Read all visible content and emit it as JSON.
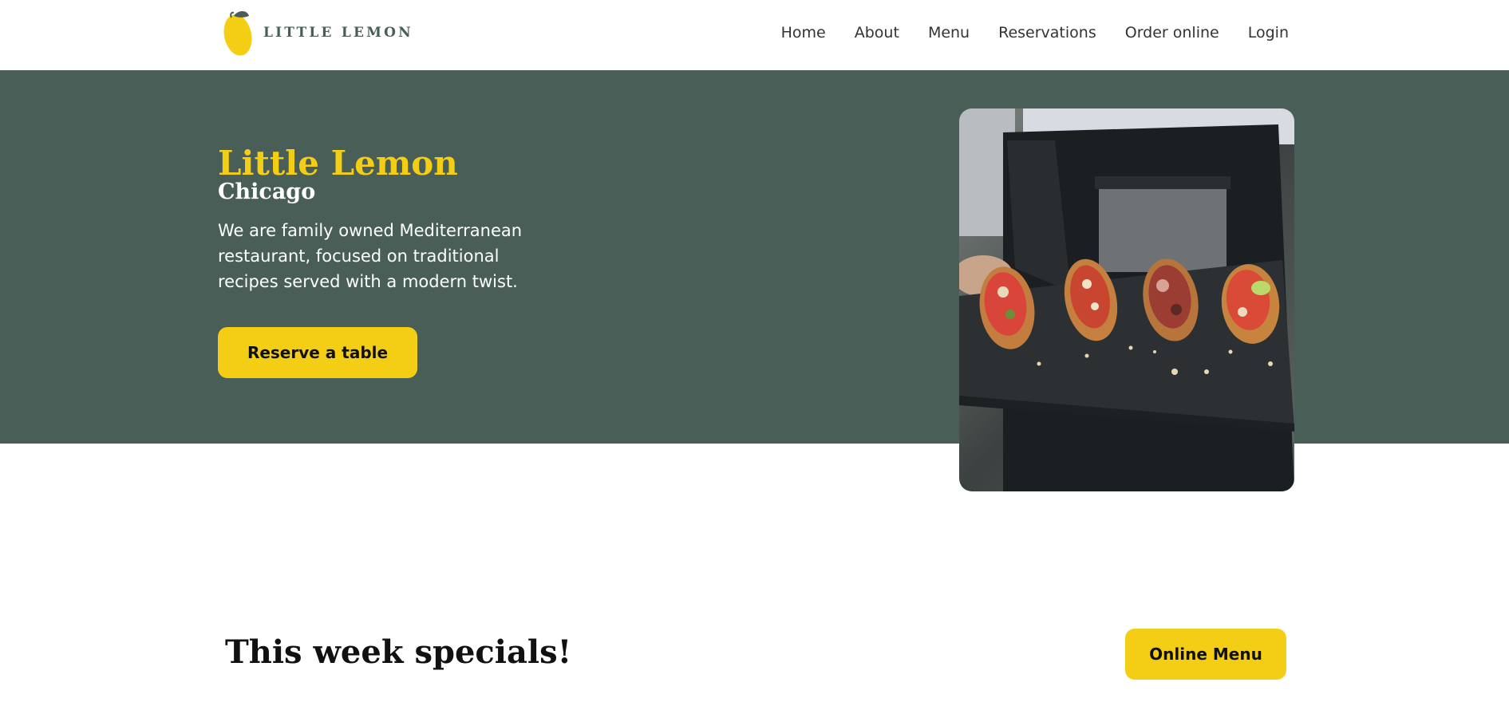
{
  "brand": {
    "name": "LITTLE LEMON",
    "primary_color": "#495E57",
    "accent_color": "#F4CE14"
  },
  "nav": {
    "items": [
      "Home",
      "About",
      "Menu",
      "Reservations",
      "Order online",
      "Login"
    ]
  },
  "hero": {
    "title": "Little Lemon",
    "subtitle": "Chicago",
    "description": "We are family owned Mediterranean restaurant, focused on traditional recipes served with a modern twist.",
    "cta_label": "Reserve a table",
    "image_icon": "chef-serving-bruschetta-photo"
  },
  "specials": {
    "title": "This week specials!",
    "button_label": "Online Menu"
  }
}
